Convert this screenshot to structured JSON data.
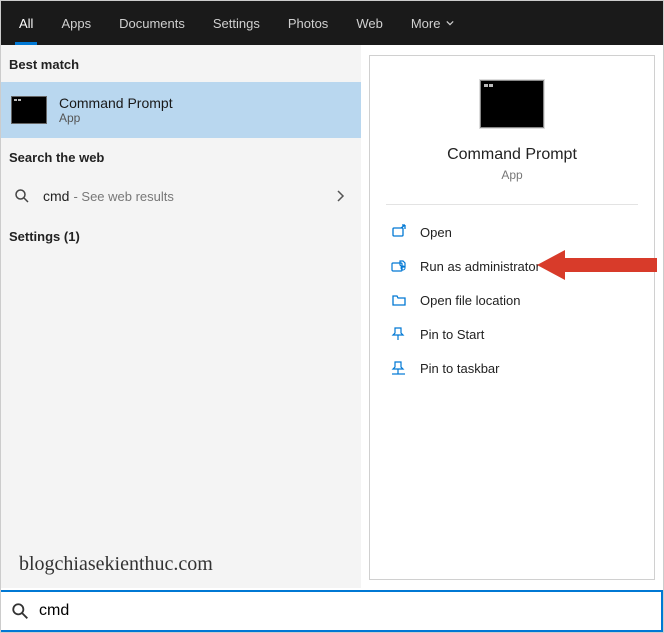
{
  "tabs": {
    "all": "All",
    "apps": "Apps",
    "documents": "Documents",
    "settings": "Settings",
    "photos": "Photos",
    "web": "Web",
    "more": "More"
  },
  "left": {
    "best_match_label": "Best match",
    "result": {
      "title": "Command Prompt",
      "subtitle": "App"
    },
    "search_web_label": "Search the web",
    "web_row": {
      "query": "cmd",
      "hint": "- See web results"
    },
    "settings_row": "Settings (1)"
  },
  "right": {
    "title": "Command Prompt",
    "subtitle": "App",
    "actions": {
      "open": "Open",
      "run_admin": "Run as administrator",
      "open_loc": "Open file location",
      "pin_start": "Pin to Start",
      "pin_taskbar": "Pin to taskbar"
    }
  },
  "search_value": "cmd",
  "watermark": "blogchiasekienthuc.com"
}
